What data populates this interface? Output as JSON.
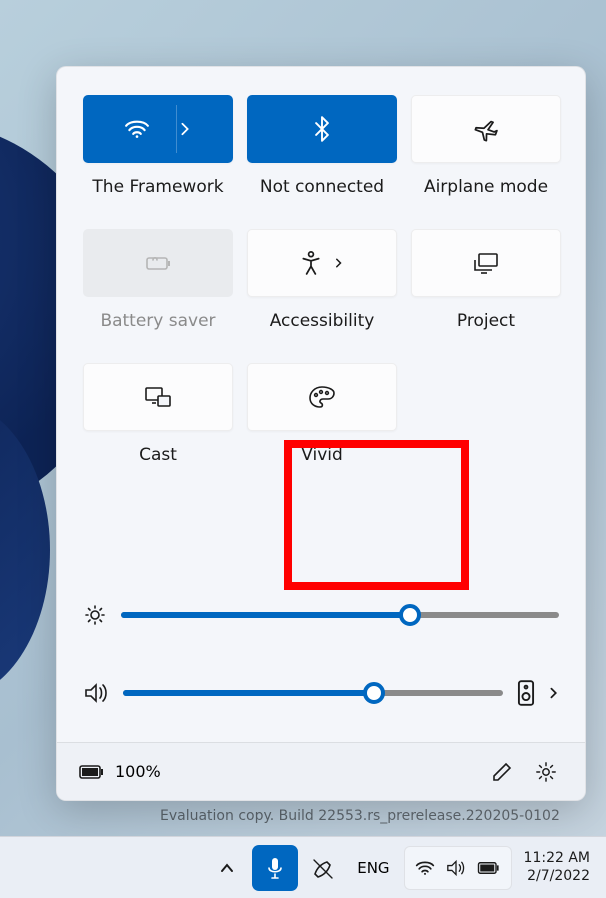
{
  "panel": {
    "tiles": [
      {
        "label": "The Framework",
        "icon": "wifi-icon",
        "active": true,
        "split": true,
        "arrowIcon": "chevron-right-icon",
        "disabled": false
      },
      {
        "label": "Not connected",
        "icon": "bluetooth-icon",
        "active": true,
        "split": false,
        "disabled": false
      },
      {
        "label": "Airplane mode",
        "icon": "airplane-icon",
        "active": false,
        "split": false,
        "disabled": false
      },
      {
        "label": "Battery saver",
        "icon": "battery-saver-icon",
        "active": false,
        "split": false,
        "disabled": true
      },
      {
        "label": "Accessibility",
        "icon": "accessibility-icon",
        "active": false,
        "split": true,
        "arrowIcon": "chevron-right-icon",
        "disabled": false
      },
      {
        "label": "Project",
        "icon": "project-icon",
        "active": false,
        "split": false,
        "disabled": false
      },
      {
        "label": "Cast",
        "icon": "cast-icon",
        "active": false,
        "split": false,
        "disabled": false
      },
      {
        "label": "Vivid",
        "icon": "palette-icon",
        "active": false,
        "split": false,
        "disabled": false,
        "highlighted": true
      }
    ],
    "brightness": {
      "valuePercent": 66
    },
    "volume": {
      "valuePercent": 66
    },
    "footer": {
      "batteryText": "100%",
      "editIcon": "pencil-icon",
      "settingsIcon": "gear-icon"
    }
  },
  "watermark": "Evaluation copy. Build 22553.rs_prerelease.220205-0102",
  "taskbar": {
    "lang": "ENG",
    "time": "11:22 AM",
    "date": "2/7/2022"
  },
  "colors": {
    "accent": "#0067c0",
    "highlight": "#ff0000"
  }
}
